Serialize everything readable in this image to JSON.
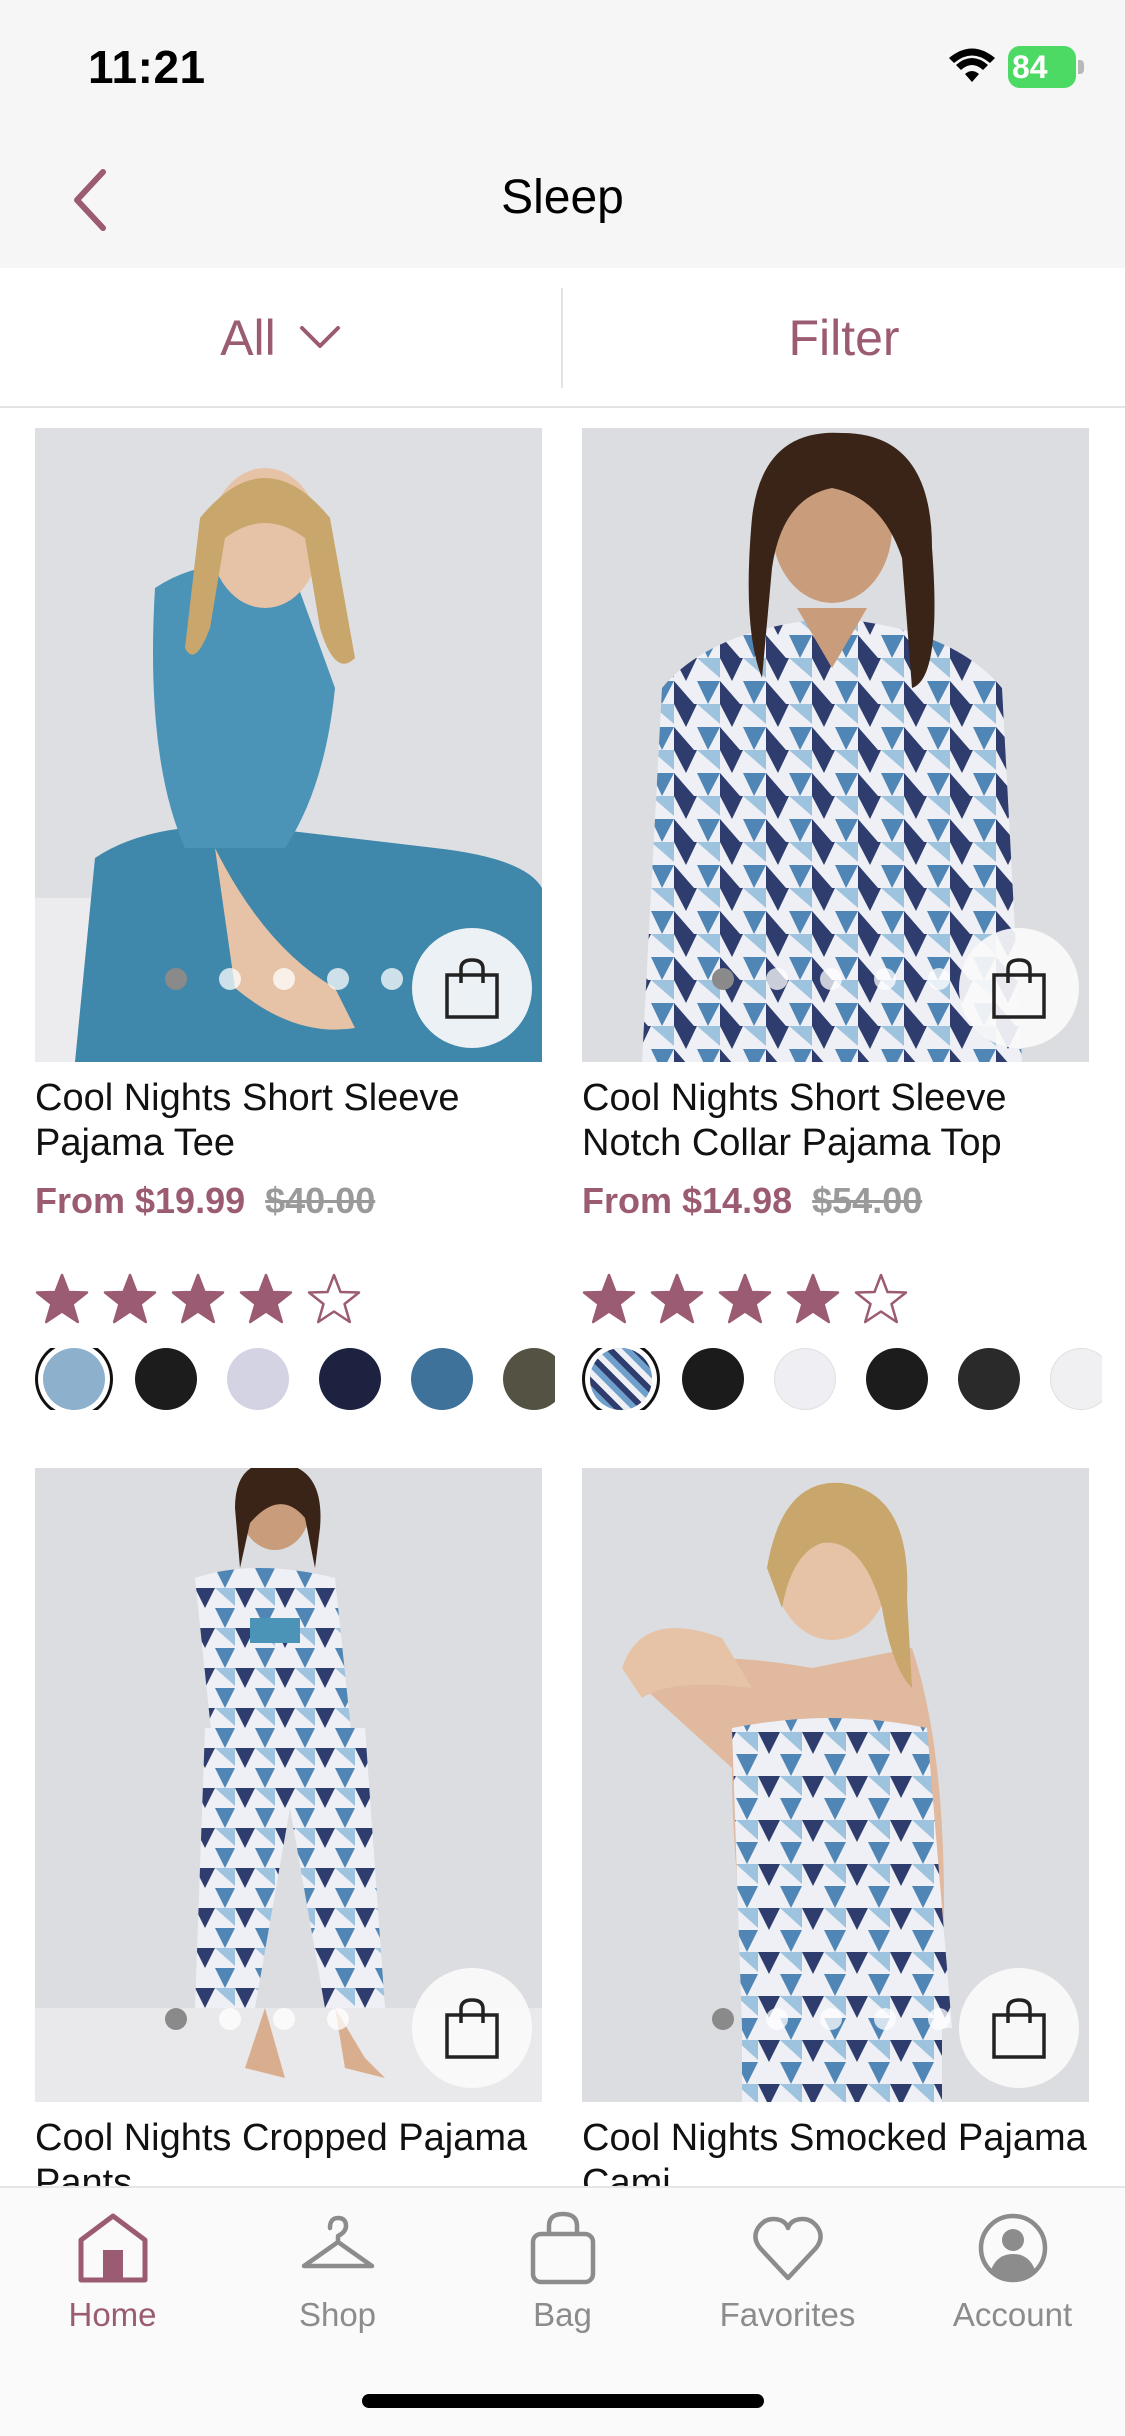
{
  "status_bar": {
    "time": "11:21",
    "battery": "84"
  },
  "nav": {
    "title": "Sleep"
  },
  "filter_bar": {
    "category_label": "All",
    "filter_label": "Filter"
  },
  "colors": {
    "accent": "#9b5b73",
    "inactive": "#8c8c8c",
    "star": "#9b5b73"
  },
  "products": [
    {
      "name": "Cool Nights Short Sleeve Pajama Tee",
      "price_prefix": "From",
      "sale_price": "$19.99",
      "original_price": "$40.00",
      "rating": 4,
      "swatches": [
        "#8db0cc",
        "#1c1c1c",
        "#d3d3e3",
        "#1d2240",
        "#3f729a",
        "#545243"
      ]
    },
    {
      "name": "Cool Nights Short Sleeve Notch Collar Pajama Top",
      "price_prefix": "From",
      "sale_price": "$14.98",
      "original_price": "$54.00",
      "rating": 4,
      "swatches": [
        "pattern-blue",
        "#1b1b1b",
        "#efeff3",
        "#1c1c1c",
        "#2a2a2a",
        "#f0f0f2"
      ]
    },
    {
      "name": "Cool Nights Cropped Pajama Pants"
    },
    {
      "name": "Cool Nights Smocked Pajama Cami"
    }
  ],
  "tab_bar": {
    "items": [
      {
        "label": "Home",
        "icon": "home-icon",
        "active": true
      },
      {
        "label": "Shop",
        "icon": "hanger-icon",
        "active": false
      },
      {
        "label": "Bag",
        "icon": "bag-icon",
        "active": false
      },
      {
        "label": "Favorites",
        "icon": "heart-icon",
        "active": false
      },
      {
        "label": "Account",
        "icon": "account-icon",
        "active": false
      }
    ]
  }
}
